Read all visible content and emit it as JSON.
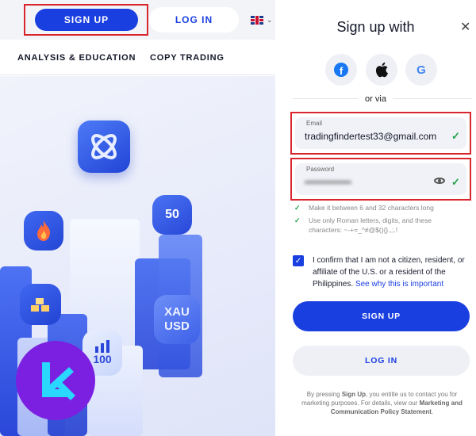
{
  "header": {
    "signup_label": "SIGN UP",
    "login_label": "LOG IN",
    "language_chevron": "⌄",
    "language_icon": "uk-flag-icon"
  },
  "nav": {
    "items": [
      {
        "label": "ANALYSIS & EDUCATION"
      },
      {
        "label": "COPY TRADING"
      }
    ]
  },
  "hero": {
    "tiles": {
      "fifty": "50",
      "xau": "XAU",
      "usd": "USD",
      "hundred": "100"
    }
  },
  "panel": {
    "title": "Sign up with",
    "close_icon": "close-icon",
    "social": [
      {
        "name": "facebook-icon",
        "glyph": "f"
      },
      {
        "name": "apple-icon",
        "glyph": ""
      },
      {
        "name": "google-icon",
        "glyph": "G"
      }
    ],
    "or_via": "or via",
    "email": {
      "label": "Email",
      "value": "tradingfindertest33@gmail.com",
      "check": "✓"
    },
    "password": {
      "label": "Password",
      "value": "••••••••••••••",
      "check": "✓"
    },
    "rules": [
      {
        "tick": "✓",
        "text": "Make it between 6 and 32 characters long"
      },
      {
        "tick": "✓",
        "text": "Use only Roman letters, digits, and these characters: ~-+=_^#@$(){}.,;.!"
      }
    ],
    "confirm": {
      "checked": true,
      "mark": "✓",
      "text": "I confirm that I am not a citizen, resident, or affiliate of the U.S. or a resident of the Philippines.",
      "link": "See why this is important"
    },
    "signup_button": "SIGN UP",
    "login_button": "LOG IN",
    "footer": {
      "pre": "By pressing ",
      "strong1": "Sign Up",
      "mid": ", you entitle us to contact you for marketing purposes. For details, view our ",
      "strong2": "Marketing and Communication Policy Statement",
      "post": "."
    }
  },
  "colors": {
    "brand_blue": "#1a3fe0",
    "highlight_red": "#d9262e",
    "check_green": "#22a24a",
    "badge_purple": "#7b1fe0"
  }
}
